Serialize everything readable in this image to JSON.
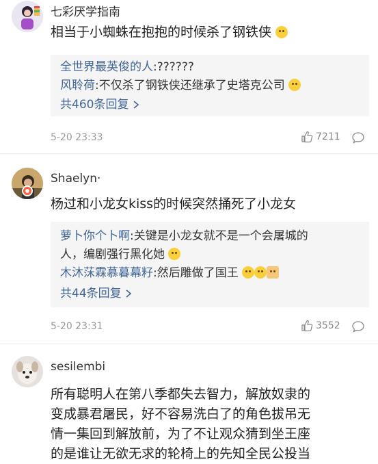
{
  "comments": [
    {
      "username": "七彩厌学指南",
      "body_lines": [
        "相当于小蜘蛛在抱抱的时候杀了钢铁侠"
      ],
      "replies": [
        {
          "name": "全世界最英俊的人",
          "text": ":??????"
        },
        {
          "name": "风聆荷",
          "text": ":不仅杀了钢铁侠还继承了史塔克公司"
        }
      ],
      "more_replies": "共460条回复",
      "timestamp": "5-20 23:33",
      "likes": "7211"
    },
    {
      "username": "Shaelyn·",
      "body_lines": [
        "杨过和小龙女kiss的时候突然捅死了小龙女"
      ],
      "replies": [
        {
          "name": "萝卜你个卜啊",
          "text": ":关键是小龙女就不是一个会屠城的",
          "text2": "人，编剧强行黑化她"
        },
        {
          "name": "木沐莯霖慕暮幕籽",
          "text": ":然后雕做了国王"
        }
      ],
      "more_replies": "共44条回复",
      "timestamp": "5-20 23:31",
      "likes": "3552"
    },
    {
      "username": "sesilembi",
      "body_lines": [
        "所有聪明人在第八季都失去智力，解放奴隶的",
        "变成暴君屠民，好不容易洗白了的角色拔吊无",
        "情一集回到解放前，为了不让观众猜到坐王座",
        "的是谁让无欲无求的轮椅上的先知全民公投当"
      ]
    }
  ],
  "icons": {
    "like": "thumbs-up-icon",
    "reply": "speech-bubble-icon",
    "more": "chevron-right-icon"
  },
  "colors": {
    "link": "#406599",
    "reply_bg": "#f5f5f5",
    "meta": "#999999"
  }
}
